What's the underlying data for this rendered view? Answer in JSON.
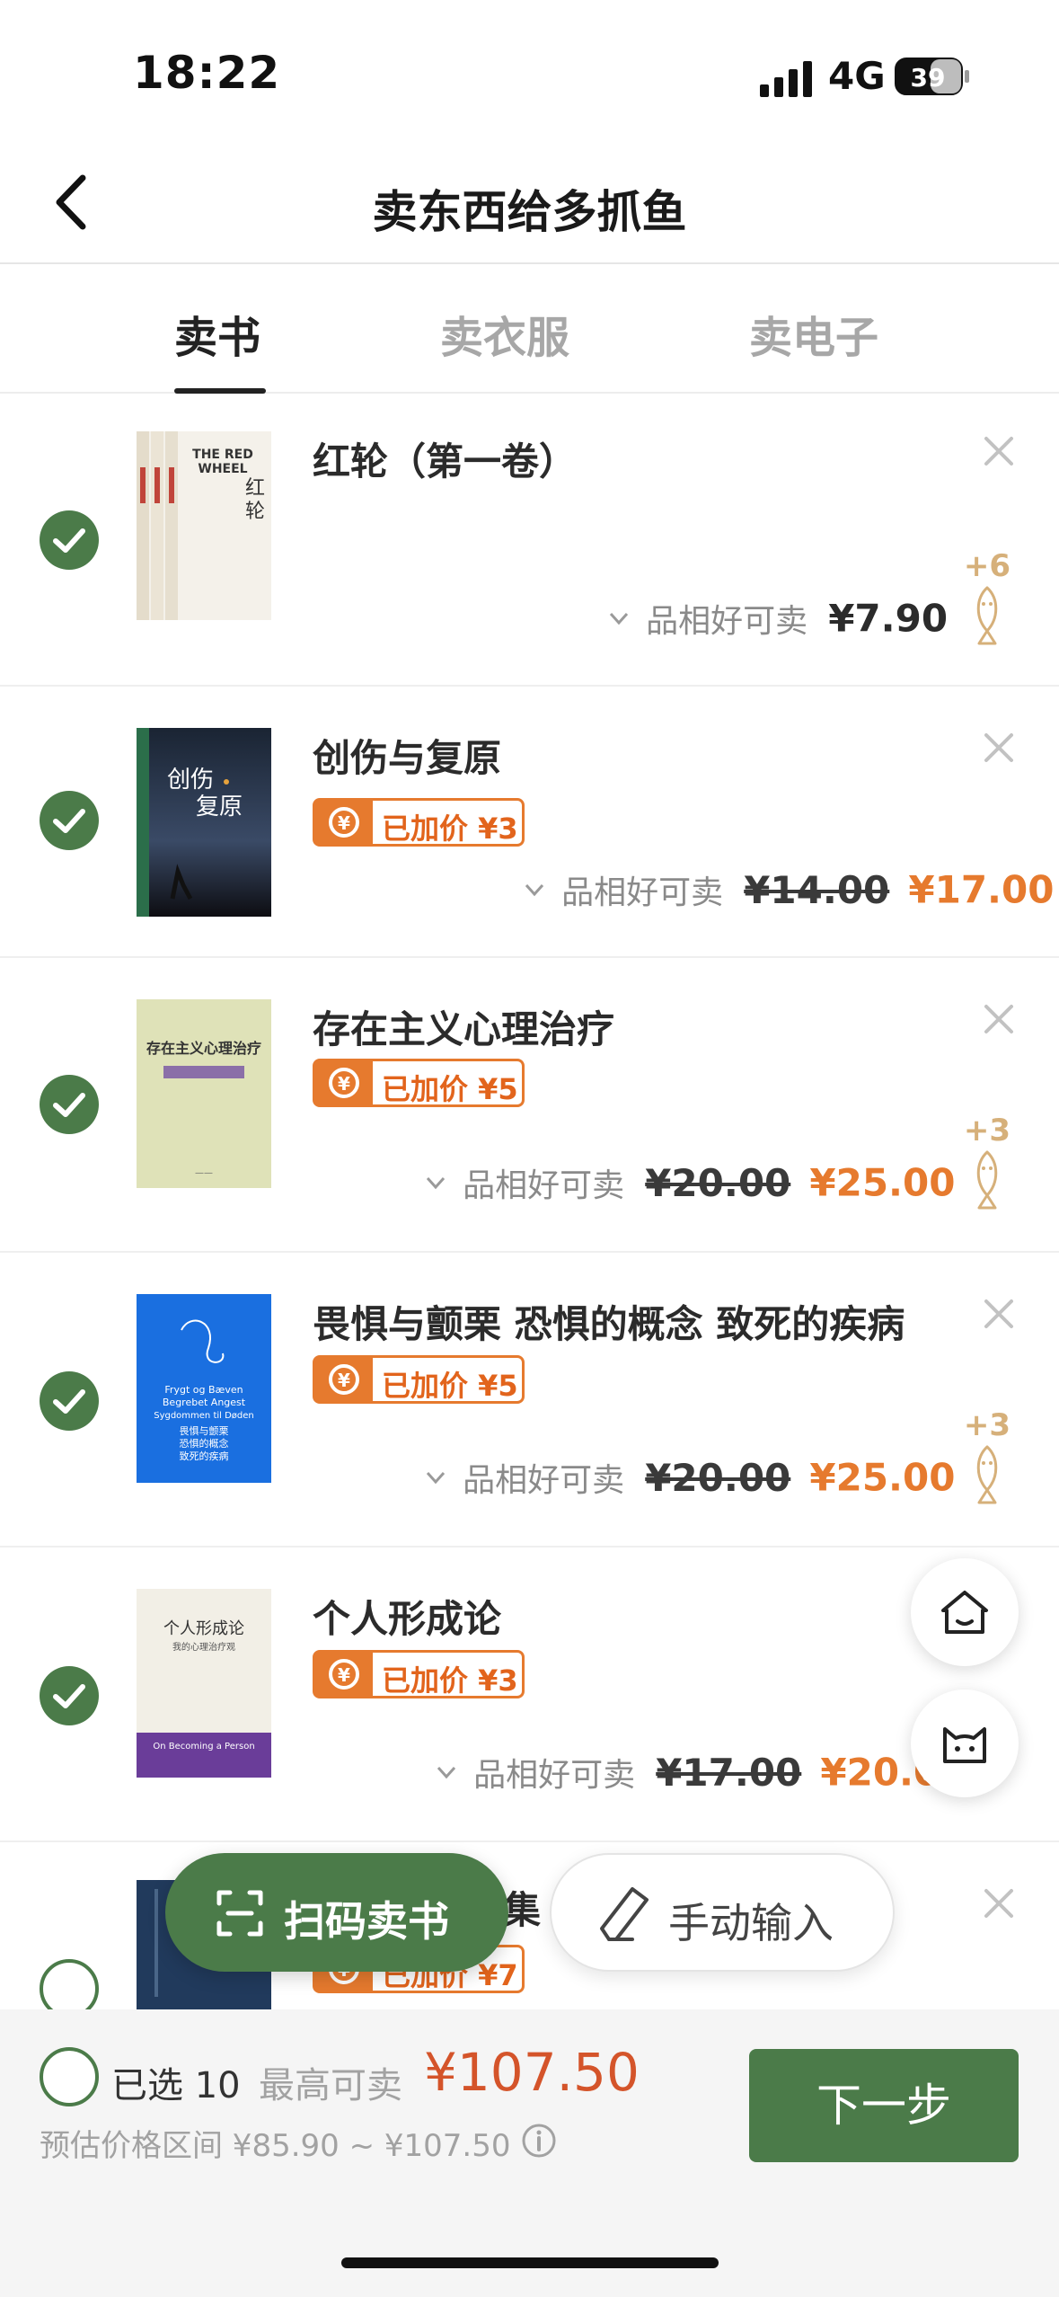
{
  "status_bar": {
    "time": "18:22",
    "network": "4G",
    "battery": "39"
  },
  "nav": {
    "title": "卖东西给多抓鱼"
  },
  "tabs": [
    {
      "label": "卖书",
      "active": true
    },
    {
      "label": "卖衣服",
      "active": false
    },
    {
      "label": "卖电子",
      "active": false
    }
  ],
  "books": [
    {
      "title": "红轮（第一卷）",
      "condition": "品相好可卖",
      "price": "¥7.90",
      "bonus": "+6",
      "selected": true,
      "cover_text": "THE RED WHEEL 红轮"
    },
    {
      "title": "创伤与复原",
      "badge": "已加价 ¥3",
      "condition": "品相好可卖",
      "old_price": "¥14.00",
      "new_price": "¥17.00",
      "selected": true,
      "cover_text": "创伤 与 复原"
    },
    {
      "title": "存在主义心理治疗",
      "badge": "已加价 ¥5",
      "condition": "品相好可卖",
      "old_price": "¥20.00",
      "new_price": "¥25.00",
      "bonus": "+3",
      "selected": true,
      "cover_text": "存在主义心理治疗"
    },
    {
      "title": "畏惧与颤栗 恐惧的概念 致死的疾病",
      "badge": "已加价 ¥5",
      "condition": "品相好可卖",
      "old_price": "¥20.00",
      "new_price": "¥25.00",
      "bonus": "+3",
      "selected": true,
      "cover_text": "Frygt og Bæven Begrebet Angest Sygdommen til Døden 畏惧与颤栗 恐惧的概念 致死的疾病"
    },
    {
      "title": "个人形成论",
      "badge": "已加价 ¥3",
      "condition": "品相好可卖",
      "old_price": "¥17.00",
      "new_price": "¥20.00",
      "selected": true,
      "cover_text": "个人形成论 我的心理治疗观 On Becoming a Person"
    },
    {
      "title": "集",
      "badge": "已加价 ¥7",
      "selected": false
    }
  ],
  "floating": {
    "scan_label": "扫码卖书",
    "manual_label": "手动输入"
  },
  "bottom": {
    "selected_label": "已选 10",
    "max_label": "最高可卖",
    "total": "¥107.50",
    "range": "预估价格区间 ¥85.90 ~ ¥107.50",
    "next_label": "下一步"
  },
  "colors": {
    "brand_green": "#4b7b49",
    "accent_orange": "#e67a2e",
    "price_red": "#d4542a",
    "bonus_gold": "#d6b07a"
  }
}
